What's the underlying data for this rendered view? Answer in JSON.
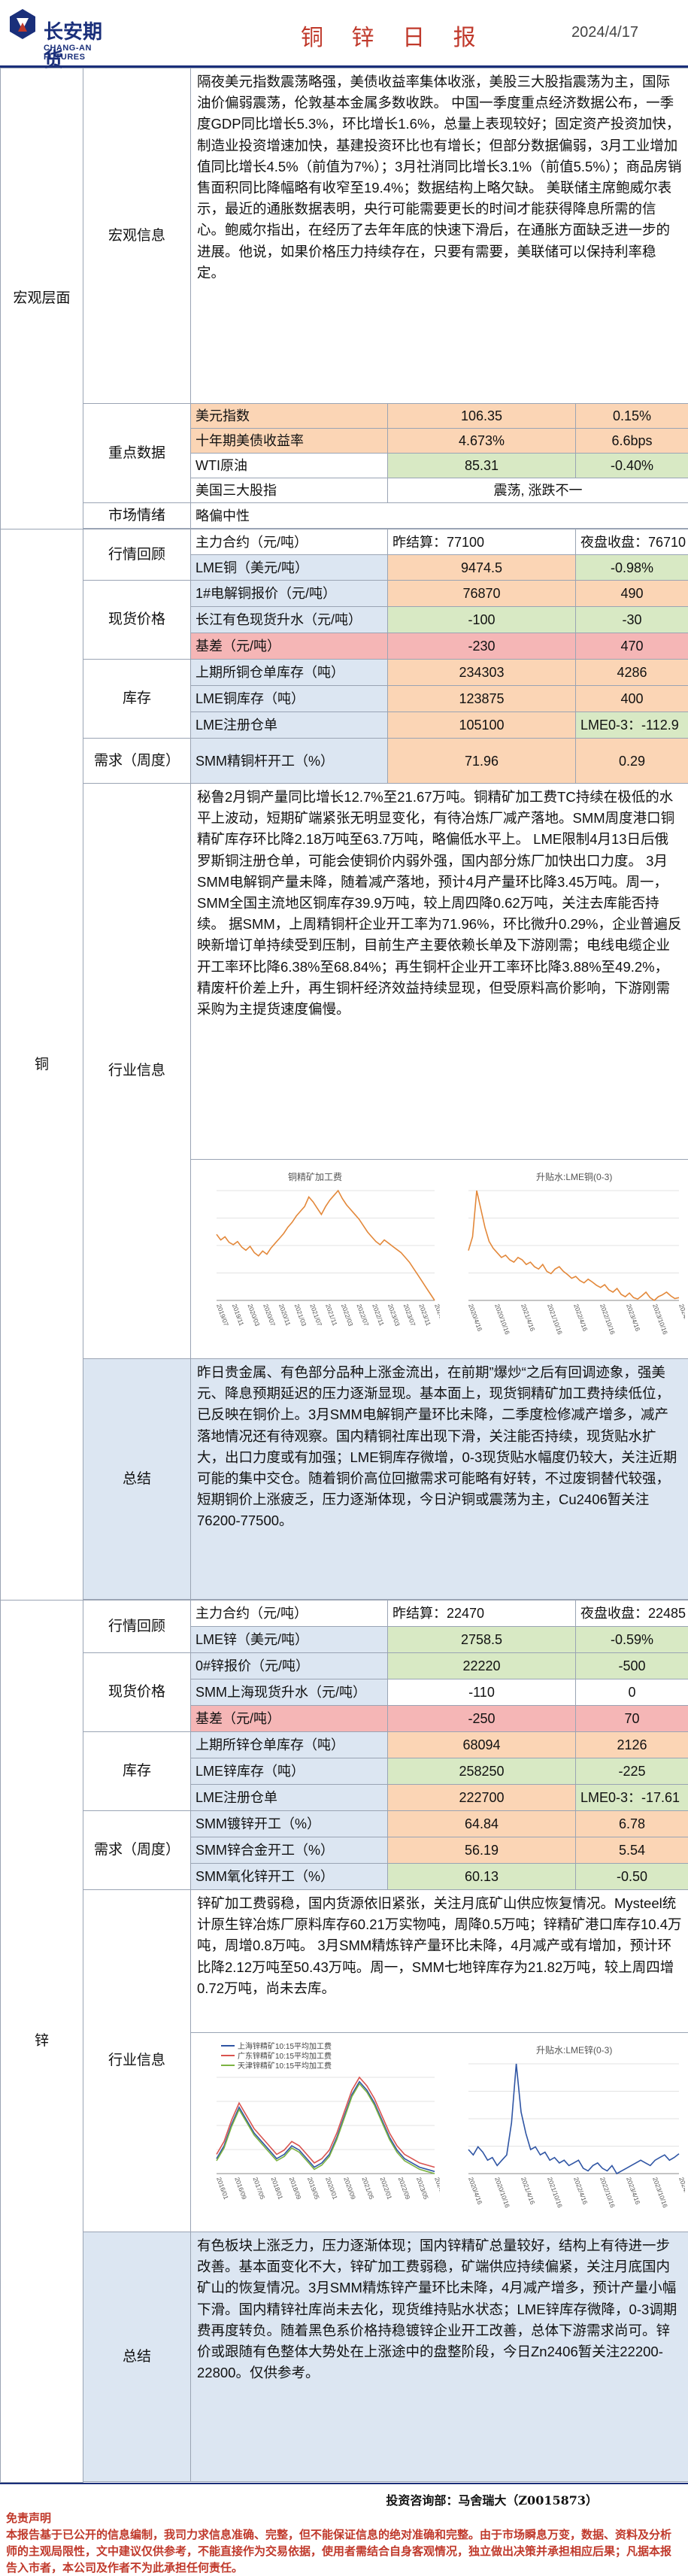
{
  "header": {
    "company_cn": "长安期货",
    "company_en": "CHANG-AN FUTURES",
    "title": "铜 锌 日 报",
    "date": "2024/4/17"
  },
  "macro": {
    "section": "宏观层面",
    "info_label": "宏观信息",
    "info_text": "隔夜美元指数震荡略强，美债收益率集体收涨，美股三大股指震荡为主，国际油价偏弱震荡，伦敦基本金属多数收跌。 中国一季度重点经济数据公布，一季度GDP同比增长5.3%，环比增长1.6%，总量上表现较好；固定资产投资加快，制造业投资增速加快，基建投资环比也有增长；但部分数据偏弱，3月工业增加值同比增长4.5%（前值为7%）；3月社消同比增长3.1%（前值5.5%）；商品房销售面积同比降幅略有收窄至19.4%；数据结构上略欠缺。 美联储主席鲍威尔表示，最近的通胀数据表明，央行可能需要更长的时间才能获得降息所需的信心。鲍威尔指出，在经历了去年年底的快速下滑后，在通胀方面缺乏进一步的进展。他说，如果价格压力持续存在，只要有需要，美联储可以保持利率稳定。",
    "key_label": "重点数据",
    "rows": [
      {
        "name": "美元指数",
        "v1": "106.35",
        "v2": "0.15%"
      },
      {
        "name": "十年期美债收益率",
        "v1": "4.673%",
        "v2": "6.6bps"
      },
      {
        "name": "WTI原油",
        "v1": "85.31",
        "v2": "-0.40%"
      },
      {
        "name": "美国三大股指",
        "v1": "",
        "v2": "震荡, 涨跌不一"
      }
    ],
    "mood_label": "市场情绪",
    "mood": "略偏中性"
  },
  "copper": {
    "section": "铜",
    "review_label": "行情回顾",
    "main": {
      "name": "主力合约（元/吨）",
      "v1": "昨结算：77100",
      "v2": "夜盘收盘：76710"
    },
    "lme": {
      "name": "LME铜（美元/吨）",
      "v1": "9474.5",
      "v2": "-0.98%"
    },
    "spot_label": "现货价格",
    "spot_rows": [
      {
        "name": "1#电解铜报价（元/吨）",
        "v1": "76870",
        "v2": "490"
      },
      {
        "name": "长江有色现货升水（元/吨）",
        "v1": "-100",
        "v2": "-30"
      },
      {
        "name": "基差（元/吨）",
        "v1": "-230",
        "v2": "470"
      }
    ],
    "stock_label": "库存",
    "stock_rows": [
      {
        "name": "上期所铜仓单库存（吨）",
        "v1": "234303",
        "v2": "4286"
      },
      {
        "name": "LME铜库存（吨）",
        "v1": "123875",
        "v2": "400"
      },
      {
        "name": "LME注册仓单",
        "v1": "105100",
        "v2": "LME0-3：-112.9"
      }
    ],
    "demand_label": "需求（周度）",
    "demand": {
      "name": "SMM精铜杆开工（%）",
      "v1": "71.96",
      "v2": "0.29"
    },
    "industry_label": "行业信息",
    "industry_text": "秘鲁2月铜产量同比增长12.7%至21.67万吨。铜精矿加工费TC持续在极低的水平上波动，短期矿端紧张无明显变化，有待冶炼厂减产落地。SMM周度港口铜精矿库存环比降2.18万吨至63.7万吨，略偏低水平上。 LME限制4月13日后俄罗斯铜注册仓单，可能会使铜价内弱外强，国内部分炼厂加快出口力度。 3月SMM电解铜产量未降，随着减产落地，预计4月产量环比降3.45万吨。周一，SMM全国主流地区铜库存39.9万吨，较上周四降0.62万吨，关注去库能否持续。 据SMM，上周精铜杆企业开工率为71.96%，环比微升0.29%，企业普遍反映新增订单持续受到压制，目前生产主要依赖长单及下游刚需；电线电缆企业开工率环比降6.38%至68.84%；再生铜杆企业开工率环比降3.88%至49.2%，精废杆价差上升，再生铜杆经济效益持续显现，但受原料高价影响，下游刚需采购为主提货速度偏慢。",
    "chart1": {
      "title": "铜精矿加工费",
      "vals": [
        95,
        88,
        92,
        85,
        82,
        86,
        79,
        75,
        80,
        72,
        68,
        74,
        70,
        78,
        84,
        90,
        96,
        104,
        110,
        118,
        124,
        130,
        142,
        136,
        128,
        120,
        130,
        138,
        144,
        150,
        140,
        132,
        126,
        120,
        114,
        106,
        98,
        92,
        86,
        82,
        88,
        84,
        80,
        76,
        72,
        66,
        60,
        52,
        44,
        36,
        28,
        20,
        12
      ],
      "xlabels": [
        "2019/07",
        "2019/11",
        "2020/03",
        "2020/07",
        "2020/11",
        "2021/03",
        "2021/07",
        "2021/11",
        "2022/03",
        "2022/07",
        "2022/11",
        "2023/03",
        "2023/07",
        "2023/11",
        "2024/03"
      ]
    },
    "chart2": {
      "title": "升贴水:LME铜(0-3)",
      "vals": [
        -10,
        20,
        120,
        80,
        40,
        10,
        -5,
        -15,
        -25,
        -20,
        -30,
        -35,
        -25,
        -30,
        -40,
        -35,
        -45,
        -50,
        -40,
        -55,
        -60,
        -50,
        -45,
        -55,
        -62,
        -70,
        -66,
        -75,
        -80,
        -72,
        -78,
        -85,
        -90,
        -84,
        -95,
        -100,
        -92,
        -105,
        -110,
        -102,
        -112,
        -115,
        -108,
        -100,
        -112,
        -118,
        -110,
        -106,
        -100,
        -108,
        -114,
        -112
      ],
      "xlabels": [
        "2020/4/16",
        "2020/10/16",
        "2021/4/16",
        "2021/10/16",
        "2022/4/16",
        "2022/10/16",
        "2023/4/16",
        "2023/10/16",
        "2024/4/16"
      ]
    },
    "summary_label": "总结",
    "summary_text": "昨日贵金属、有色部分品种上涨金流出，在前期”爆炒“之后有回调迹象，强美元、降息预期延迟的压力逐渐显现。基本面上，现货铜精矿加工费持续低位，已反映在铜价上。3月SMM电解铜产量环比未降，二季度检修减产增多，减产落地情况还有待观察。国内精铜社库出现下滑，关注能否持续，现货贴水扩大，出口力度或有加强；LME铜库存微增，0-3现货贴水幅度仍较大，关注近期可能的集中交仓。随着铜价高位回撤需求可能略有好转，不过废铜替代较强，短期铜价上涨疲乏，压力逐渐体现，今日沪铜或震荡为主，Cu2406暂关注76200-77500。"
  },
  "zinc": {
    "section": "锌",
    "review_label": "行情回顾",
    "main": {
      "name": "主力合约（元/吨）",
      "v1": "昨结算：22470",
      "v2": "夜盘收盘：22485"
    },
    "lme": {
      "name": "LME锌（美元/吨）",
      "v1": "2758.5",
      "v2": "-0.59%"
    },
    "spot_label": "现货价格",
    "spot_rows": [
      {
        "name": "0#锌报价（元/吨）",
        "v1": "22220",
        "v2": "-500"
      },
      {
        "name": "SMM上海现货升水（元/吨）",
        "v1": "-110",
        "v2": "0"
      },
      {
        "name": "基差（元/吨）",
        "v1": "-250",
        "v2": "70"
      }
    ],
    "stock_label": "库存",
    "stock_rows": [
      {
        "name": "上期所锌仓单库存（吨）",
        "v1": "68094",
        "v2": "2126"
      },
      {
        "name": "LME锌库存（吨）",
        "v1": "258250",
        "v2": "-225"
      },
      {
        "name": "LME注册仓单",
        "v1": "222700",
        "v2": "LME0-3：-17.61"
      }
    ],
    "demand_label": "需求（周度）",
    "demand_rows": [
      {
        "name": "SMM镀锌开工（%）",
        "v1": "64.84",
        "v2": "6.78"
      },
      {
        "name": "SMM锌合金开工（%）",
        "v1": "56.19",
        "v2": "5.54"
      },
      {
        "name": "SMM氧化锌开工（%）",
        "v1": "60.13",
        "v2": "-0.50"
      }
    ],
    "industry_label": "行业信息",
    "industry_text": "锌矿加工费弱稳，国内货源依旧紧张，关注月底矿山供应恢复情况。Mysteel统计原生锌冶炼厂原料库存60.21万实物吨，周降0.5万吨；锌精矿港口库存10.4万吨，周增0.8万吨。 3月SMM精炼锌产量环比未降，4月减产或有增加，预计环比降2.12万吨至50.43万吨。周一，SMM七地锌库存为21.82万吨，较上周四增0.72万吨，尚未去库。",
    "chart1": {
      "legend": [
        "上海锌精矿10:15平均加工费",
        "广东锌精矿10:15平均加工费",
        "天津锌精矿10:15平均加工费"
      ],
      "colors": [
        "#2f55a4",
        "#d9534f",
        "#7cb342"
      ],
      "vals": [
        [
          40,
          70,
          120,
          160,
          130,
          100,
          80,
          60,
          40,
          50,
          70,
          60,
          40,
          20,
          30,
          50,
          90,
          140,
          190,
          220,
          200,
          170,
          130,
          90,
          60,
          40,
          30,
          20,
          15,
          10
        ],
        [
          50,
          80,
          130,
          170,
          140,
          110,
          90,
          70,
          50,
          60,
          80,
          70,
          50,
          30,
          40,
          60,
          100,
          150,
          200,
          230,
          210,
          180,
          140,
          100,
          70,
          50,
          40,
          30,
          25,
          20
        ],
        [
          35,
          65,
          115,
          155,
          125,
          95,
          75,
          55,
          35,
          45,
          65,
          55,
          35,
          15,
          25,
          45,
          85,
          135,
          185,
          215,
          195,
          165,
          125,
          85,
          55,
          35,
          25,
          15,
          10,
          5
        ]
      ],
      "xlabels": [
        "2016/01",
        "2016/09",
        "2017/05",
        "2018/01",
        "2018/09",
        "2019/05",
        "2020/01",
        "2020/09",
        "2021/05",
        "2022/01",
        "2022/09",
        "2023/05",
        "2024/01"
      ]
    },
    "chart2": {
      "title": "升贴水:LME锌(0-3)",
      "vals": [
        -10,
        -20,
        -5,
        -15,
        -30,
        -25,
        -40,
        -30,
        -20,
        40,
        150,
        60,
        20,
        -10,
        -5,
        -20,
        -15,
        -30,
        -25,
        -35,
        -30,
        -40,
        -35,
        -30,
        -45,
        -50,
        -40,
        -35,
        -45,
        -50,
        -40,
        -55,
        -50,
        -45,
        -40,
        -35,
        -30,
        -35,
        -40,
        -30,
        -25,
        -20,
        -30,
        -25,
        -18
      ],
      "xlabels": [
        "2020/4/16",
        "2020/10/16",
        "2021/4/16",
        "2021/10/16",
        "2022/4/16",
        "2022/10/16",
        "2023/4/16",
        "2023/10/16",
        "2024/4/16"
      ]
    },
    "summary_label": "总结",
    "summary_text": "有色板块上涨乏力，压力逐渐体现；国内锌精矿总量较好，结构上有待进一步改善。基本面变化不大，锌矿加工费弱稳，矿端供应持续偏紧，关注月底国内矿山的恢复情况。3月SMM精炼锌产量环比未降，4月减产增多，预计产量小幅下滑。国内精锌社库尚未去化，现货维持贴水状态；LME锌库存微降，0-3调期费再度转负。随着黑色系价格持稳镀锌企业开工改善，总体下游需求尚可。锌价或跟随有色整体大势处在上涨途中的盘整阶段，今日Zn2406暂关注22200-22800。仅供参考。"
  },
  "footer": {
    "analyst": "投资咨询部：马舍瑞大（Z0015873）",
    "disclaimer_title": "免责声明",
    "disclaimer": "本报告基于已公开的信息编制，我司力求信息准确、完整，但不能保证信息的绝对准确和完整。由于市场瞬息万变，数据、资料及分析师的主观局限性，文中建议仅供参考，不能直接作为交易依据，使用者需结合自身客观情况，独立做出决策并承担相应后果；凡据本报告入市者，本公司及作者不为此承担任何责任。"
  }
}
